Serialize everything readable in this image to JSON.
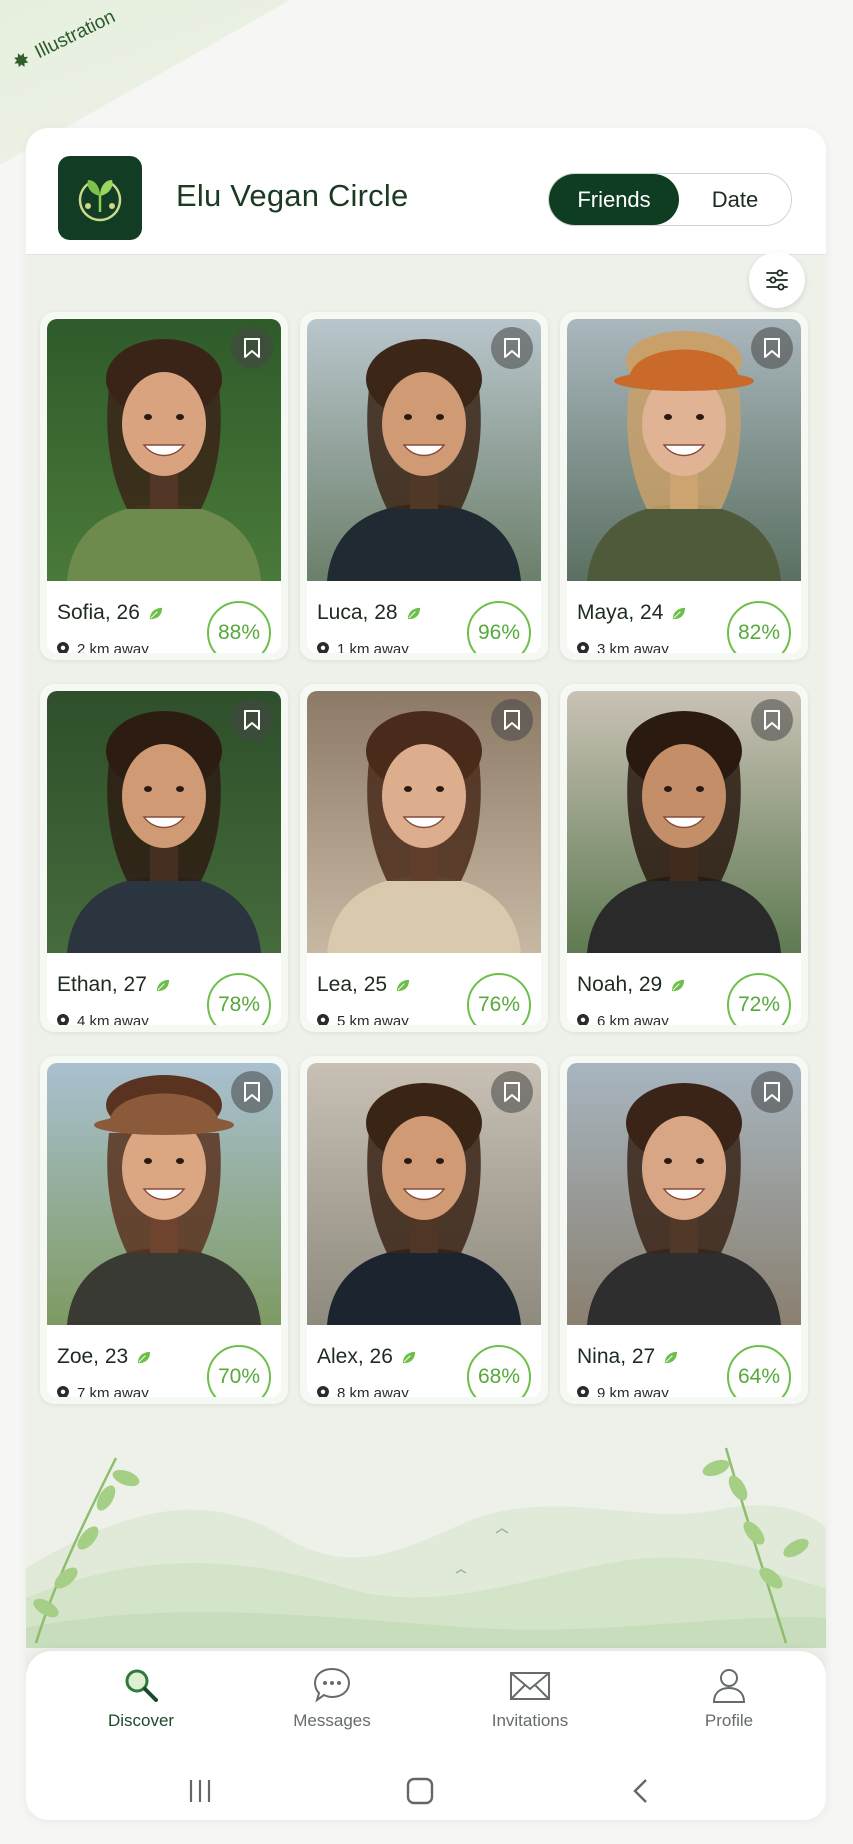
{
  "corner_label": "Illustration",
  "header": {
    "app_title": "Elu Vegan Circle",
    "mode_friends": "Friends",
    "mode_date": "Date",
    "active_mode": "Friends"
  },
  "colors": {
    "brand_dark": "#0f3d22",
    "accent_green": "#56a93a",
    "match_ring": "#6cbf4a"
  },
  "profiles": [
    {
      "name": "Sofia, 26",
      "distance": "2 km away",
      "match": "88%"
    },
    {
      "name": "Luca, 28",
      "distance": "1 km away",
      "match": "96%"
    },
    {
      "name": "Maya, 24",
      "distance": "3 km away",
      "match": "82%"
    },
    {
      "name": "Ethan, 27",
      "distance": "4 km away",
      "match": "78%"
    },
    {
      "name": "Lea, 25",
      "distance": "5 km away",
      "match": "76%"
    },
    {
      "name": "Noah, 29",
      "distance": "6 km away",
      "match": "72%"
    },
    {
      "name": "Zoe, 23",
      "distance": "7 km away",
      "match": "70%"
    },
    {
      "name": "Alex, 26",
      "distance": "8 km away",
      "match": "68%"
    },
    {
      "name": "Nina, 27",
      "distance": "9 km away",
      "match": "64%"
    }
  ],
  "nav": {
    "discover": "Discover",
    "messages": "Messages",
    "invitations": "Invitations",
    "profile": "Profile",
    "active": "Discover"
  },
  "icons": {
    "filter": "sliders-icon",
    "bookmark": "bookmark-icon",
    "verified": "leaf-icon",
    "location": "pin-icon"
  }
}
